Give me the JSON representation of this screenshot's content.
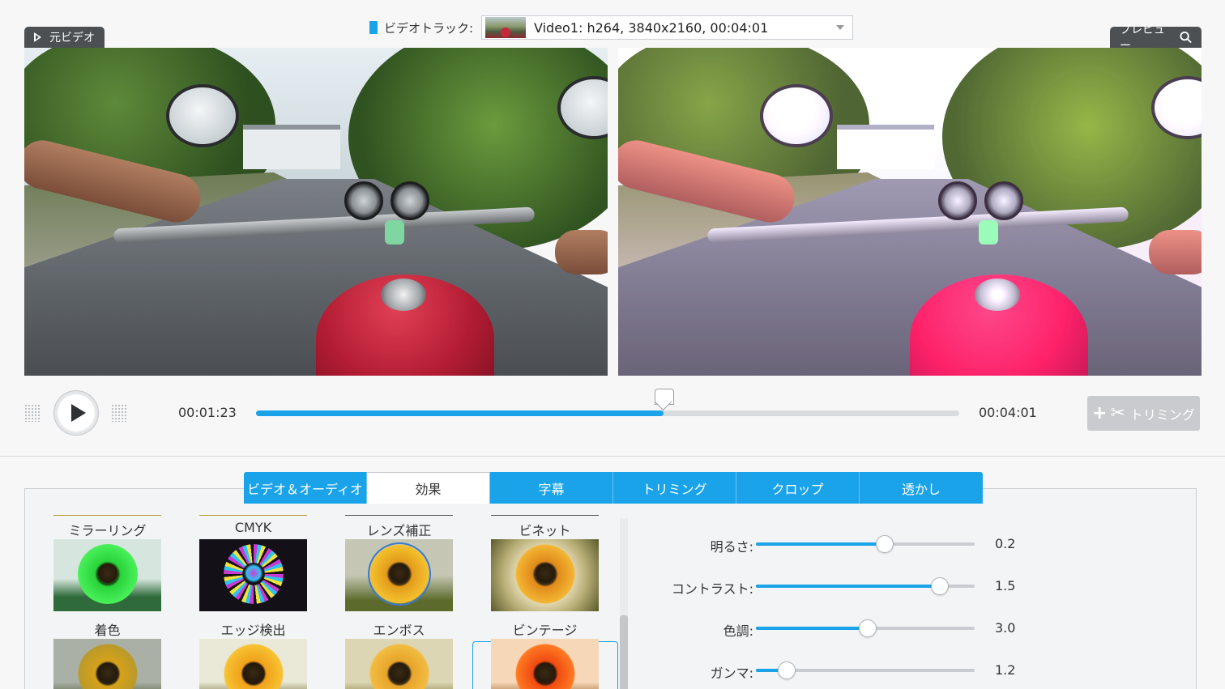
{
  "track": {
    "label": "ビデオトラック:",
    "value": "Video1: h264, 3840x2160, 00:04:01"
  },
  "source_label": "元ビデオ",
  "preview_label": "プレビュー",
  "playback": {
    "current_time": "00:01:23",
    "total_time": "00:04:01",
    "progress": 0.58,
    "trim_label": "トリミング"
  },
  "tabs": [
    {
      "label": "ビデオ＆オーディオ",
      "active": false
    },
    {
      "label": "効果",
      "active": true
    },
    {
      "label": "字幕",
      "active": false
    },
    {
      "label": "トリミング",
      "active": false
    },
    {
      "label": "クロップ",
      "active": false
    },
    {
      "label": "透かし",
      "active": false
    }
  ],
  "effects": [
    {
      "name": "ミラーリング"
    },
    {
      "name": "CMYK"
    },
    {
      "name": "レンズ補正"
    },
    {
      "name": "ビネット"
    },
    {
      "name": "着色"
    },
    {
      "name": "エッジ検出"
    },
    {
      "name": "エンボス"
    },
    {
      "name": "ビンテージ",
      "selected": true
    }
  ],
  "adjustments": [
    {
      "label": "明るさ:",
      "value": "0.2",
      "level": 0.59
    },
    {
      "label": "コントラスト:",
      "value": "1.5",
      "level": 0.84
    },
    {
      "label": "色調:",
      "value": "3.0",
      "level": 0.51
    },
    {
      "label": "ガンマ:",
      "value": "1.2",
      "level": 0.14
    }
  ],
  "colors": {
    "accent": "#1aa3e8",
    "label_bg": "#4c5053"
  }
}
